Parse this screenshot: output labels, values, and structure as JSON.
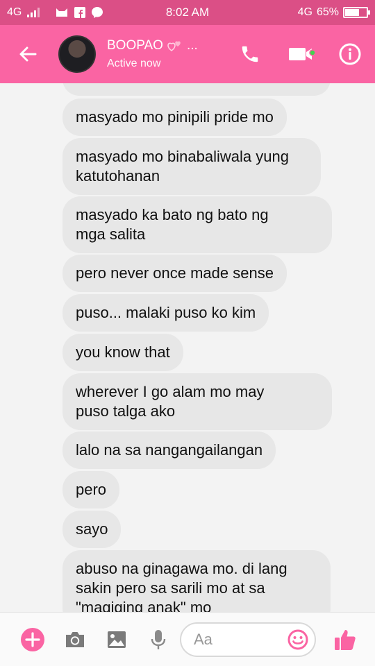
{
  "status_bar": {
    "network_left": "4G",
    "time": "8:02 AM",
    "network_right": "4G",
    "battery": "65%",
    "battery_level": 0.65
  },
  "header": {
    "contact_name": "BOOPAO",
    "name_overflow": "...",
    "presence": "Active now",
    "accent_color": "#fa64a3",
    "icons": [
      "back-arrow-icon",
      "phone-icon",
      "video-camera-icon",
      "info-icon"
    ]
  },
  "messages": [
    "masyado mo pinipili pride mo",
    "masyado mo binabaliwala yung katutohanan",
    "masyado ka bato ng bato ng mga salita",
    "pero never once made sense",
    "puso... malaki puso ko kim",
    "you know that",
    "wherever I go alam mo may puso talga ako",
    "lalo na sa nangangailangan",
    "pero",
    "sayo",
    "abuso na ginagawa mo. di lang sakin pero sa sarili mo at sa \"magiging anak\" mo"
  ],
  "composer": {
    "placeholder": "Aa",
    "icons": [
      "plus-icon",
      "camera-icon",
      "image-icon",
      "microphone-icon",
      "emoji-icon",
      "thumbs-up-icon"
    ]
  }
}
